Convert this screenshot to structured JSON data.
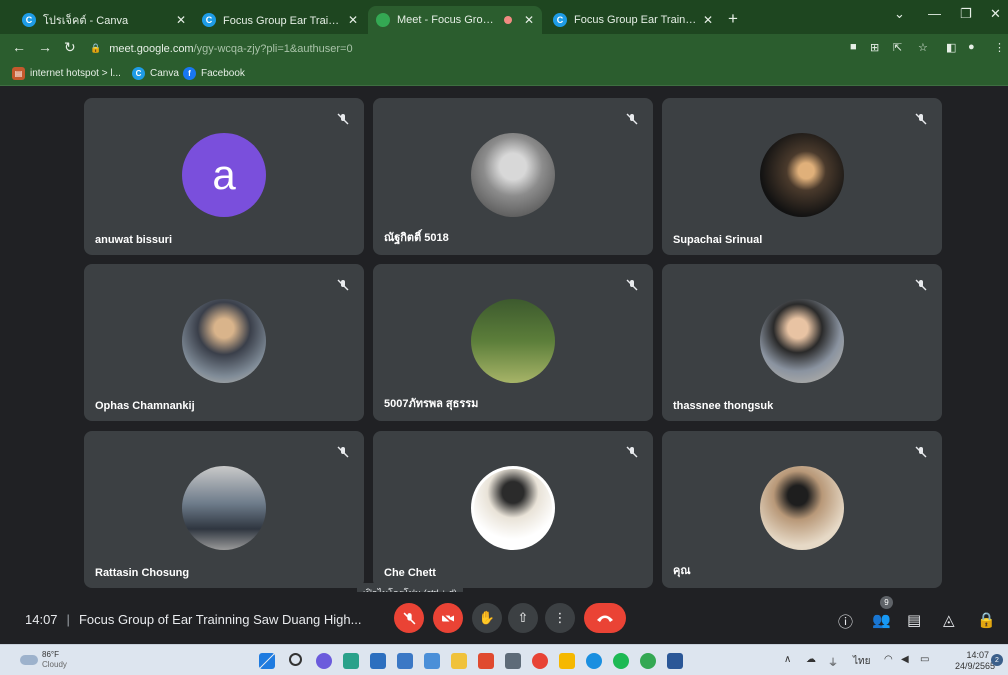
{
  "browser": {
    "tabs": [
      {
        "title": "โปรเจ็คต์ - Canva"
      },
      {
        "title": "Focus Group Ear Trainning - งานน้"
      },
      {
        "title": "Meet - Focus Group of Ear T"
      },
      {
        "title": "Focus Group Ear Trainning"
      }
    ],
    "url": {
      "host": "meet.google.com",
      "path": "/ygy-wcqa-zjy?pli=1&authuser=0"
    },
    "bookmarks": [
      {
        "label": "internet hotspot > l..."
      },
      {
        "label": "Canva"
      },
      {
        "label": "Facebook"
      }
    ]
  },
  "participants": [
    {
      "name": "anuwat bissuri",
      "initial": "a"
    },
    {
      "name": "ณัฐกิตติ์ 5018"
    },
    {
      "name": "Supachai Srinual"
    },
    {
      "name": "Ophas Chamnankij"
    },
    {
      "name": "5007ภัทรพล สุธรรม"
    },
    {
      "name": "thassnee thongsuk"
    },
    {
      "name": "Rattasin Chosung"
    },
    {
      "name": "Che Chett"
    },
    {
      "name": "คุณ"
    }
  ],
  "meeting": {
    "time": "14:07",
    "title": "Focus Group of Ear Trainning Saw Duang High...",
    "mic_tooltip": "เปิดไมโครโฟน (ctrl + d)",
    "people_count": "9"
  },
  "taskbar": {
    "weather_temp": "86°F",
    "weather_desc": "Cloudy",
    "lang": "ไทย",
    "time": "14:07",
    "date": "24/9/2565",
    "notifications": "2"
  }
}
